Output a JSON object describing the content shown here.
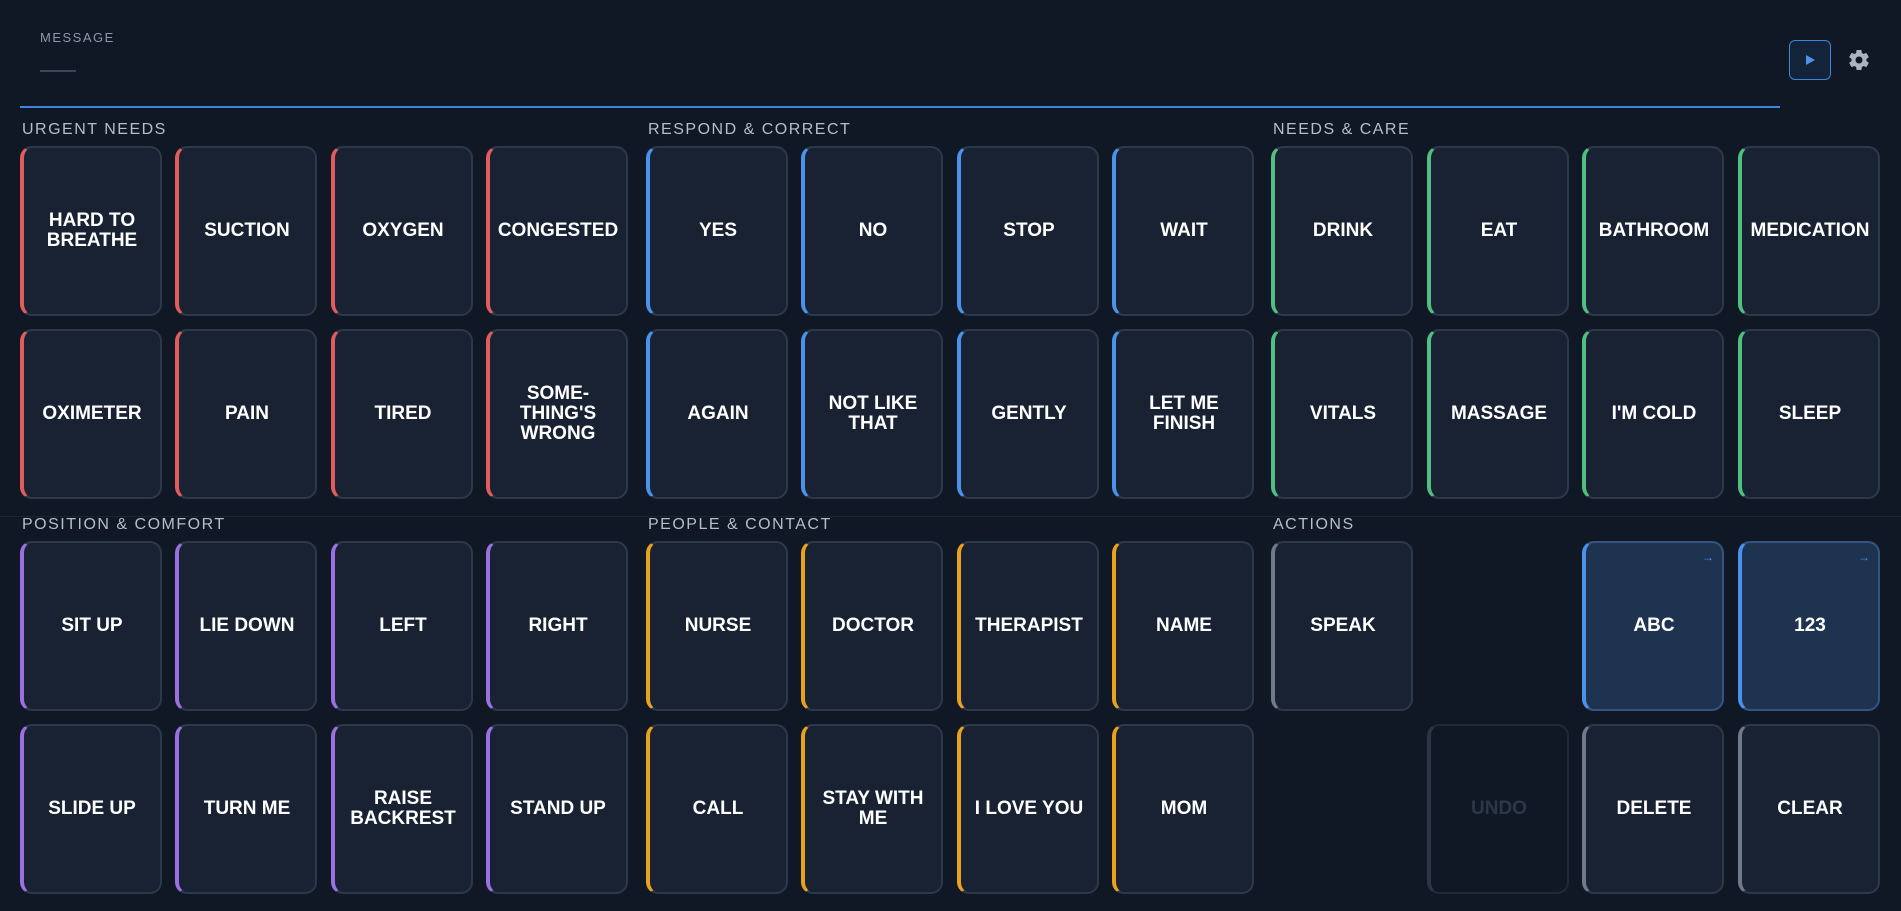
{
  "message": {
    "label": "MESSAGE",
    "value": ""
  },
  "colors": {
    "urgent": "#e25c5c",
    "respond": "#4a92ea",
    "care": "#4fc07f",
    "position": "#9b70e0",
    "people": "#eaa21e",
    "actions": "#6f7b8a"
  },
  "icons": {
    "play": "play-icon",
    "settings": "gear-icon",
    "nav_arrow": "arrow-right-icon"
  },
  "sections": {
    "urgent": {
      "title": "URGENT NEEDS",
      "tiles": [
        "HARD TO BREATHE",
        "SUCTION",
        "OXYGEN",
        "CONGESTED",
        "OXIMETER",
        "PAIN",
        "TIRED",
        "SOME-THING'S WRONG"
      ]
    },
    "respond": {
      "title": "RESPOND & CORRECT",
      "tiles": [
        "YES",
        "NO",
        "STOP",
        "WAIT",
        "AGAIN",
        "NOT LIKE THAT",
        "GENTLY",
        "LET ME FINISH"
      ]
    },
    "care": {
      "title": "NEEDS & CARE",
      "tiles": [
        "DRINK",
        "EAT",
        "BATHROOM",
        "MEDICATION",
        "VITALS",
        "MASSAGE",
        "I'M COLD",
        "SLEEP"
      ]
    },
    "position": {
      "title": "POSITION & COMFORT",
      "tiles": [
        "SIT UP",
        "LIE DOWN",
        "LEFT",
        "RIGHT",
        "SLIDE UP",
        "TURN ME",
        "RAISE BACKREST",
        "STAND UP"
      ]
    },
    "people": {
      "title": "PEOPLE & CONTACT",
      "tiles": [
        "NURSE",
        "DOCTOR",
        "THERAPIST",
        "NAME",
        "CALL",
        "STAY WITH ME",
        "I LOVE YOU",
        "MOM"
      ]
    },
    "actions": {
      "title": "ACTIONS",
      "speak": "SPEAK",
      "abc": "ABC",
      "numbers": "123",
      "arrow": "→",
      "undo": "UNDO",
      "delete": "DELETE",
      "clear": "CLEAR"
    }
  }
}
